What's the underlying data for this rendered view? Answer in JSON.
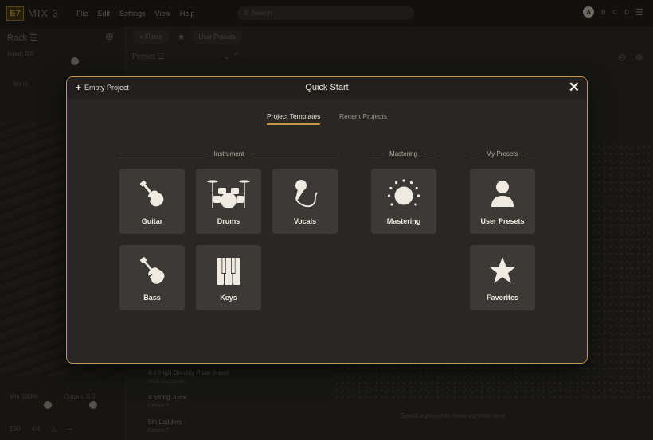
{
  "app": {
    "logo": "E7",
    "name": "MIX 3",
    "menu": [
      "File",
      "Edit",
      "Settings",
      "View",
      "Help"
    ],
    "search_placeholder": "Search",
    "slots": [
      "A",
      "B",
      "C",
      "D"
    ]
  },
  "rack": {
    "title": "Rack",
    "input_label": "Input: 0.0",
    "none_label": "None",
    "mix_label": "Mix 100%",
    "output_label": "Output: 0.0",
    "tempo": "120",
    "signature": "4/4"
  },
  "toolbar": {
    "filters_label": "Filters",
    "user_presets_label": "User Presets",
    "preset_label": "Preset"
  },
  "background_presets": [
    {
      "name": "4 x High Density Plate Insert",
      "sub": "Mick Guzauski"
    },
    {
      "name": "4 String Juice",
      "sub": "Cenzo T"
    },
    {
      "name": "5th Ladders",
      "sub": "Cenzo T"
    }
  ],
  "select_hint": "Select a preset to show controls here",
  "modal": {
    "empty_project_label": "Empty Project",
    "title": "Quick Start",
    "tabs": [
      {
        "label": "Project Templates",
        "active": true
      },
      {
        "label": "Recent Projects",
        "active": false
      }
    ],
    "sections": {
      "instrument": "Instrument",
      "mastering": "Mastering",
      "my_presets": "My Presets"
    },
    "tiles": {
      "guitar": {
        "label": "Guitar",
        "icon": "acoustic-guitar-icon"
      },
      "drums": {
        "label": "Drums",
        "icon": "drum-kit-icon"
      },
      "vocals": {
        "label": "Vocals",
        "icon": "microphone-icon"
      },
      "bass": {
        "label": "Bass",
        "icon": "bass-guitar-icon"
      },
      "keys": {
        "label": "Keys",
        "icon": "piano-keys-icon"
      },
      "mastering": {
        "label": "Mastering",
        "icon": "mastering-knob-icon"
      },
      "user_presets": {
        "label": "User Presets",
        "icon": "user-icon"
      },
      "favorites": {
        "label": "Favorites",
        "icon": "star-icon"
      }
    }
  },
  "colors": {
    "accent": "#c4954b",
    "tile": "#3d3936",
    "modal_bg": "#2a2623"
  }
}
